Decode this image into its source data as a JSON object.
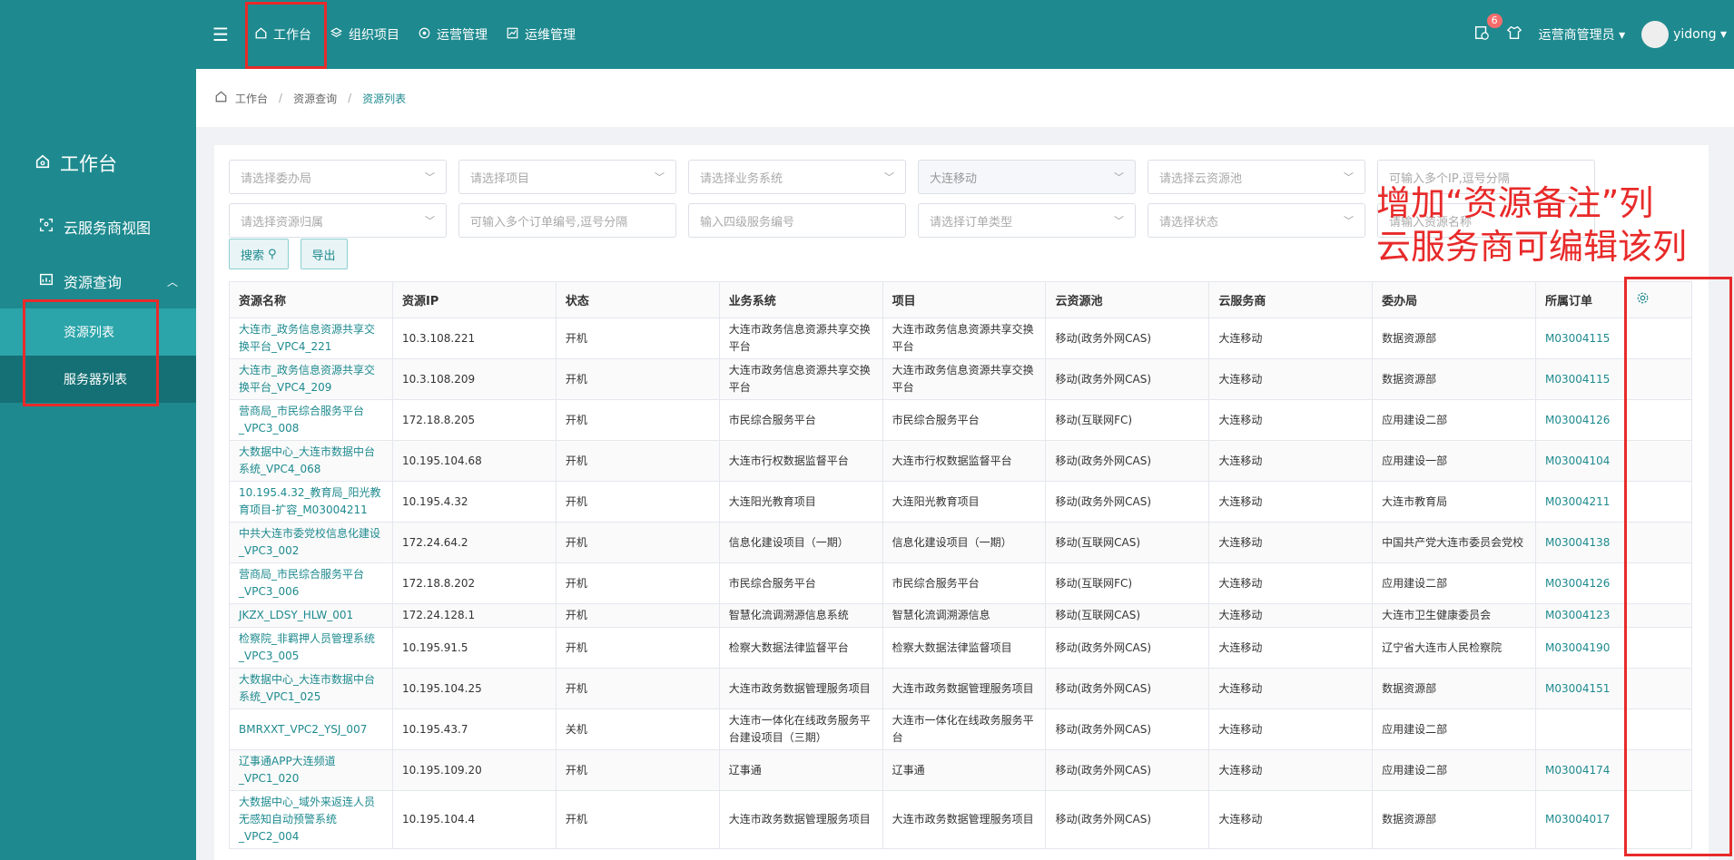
{
  "sidebar": {
    "title": "工作台",
    "items": [
      {
        "label": "云服务商视图"
      },
      {
        "label": "资源查询"
      }
    ],
    "sub_items": [
      {
        "label": "资源列表"
      },
      {
        "label": "服务器列表"
      }
    ]
  },
  "topnav": {
    "items": [
      {
        "label": "工作台"
      },
      {
        "label": "组织项目"
      },
      {
        "label": "运营管理"
      },
      {
        "label": "运维管理"
      }
    ],
    "badge_count": "6",
    "role": "运营商管理员",
    "user": "yidong"
  },
  "breadcrumb": [
    "工作台",
    "资源查询",
    "资源列表"
  ],
  "filters": {
    "row1": [
      "请选择委办局",
      "请选择项目",
      "请选择业务系统",
      "大连移动",
      "请选择云资源池",
      "可输入多个IP,逗号分隔"
    ],
    "row2": [
      "请选择资源归属",
      "可输入多个订单编号,逗号分隔",
      "输入四级服务编号",
      "请选择订单类型",
      "请选择状态",
      "请输入资源名称"
    ]
  },
  "buttons": {
    "search": "搜索",
    "export": "导出"
  },
  "annotation": {
    "line1": "增加“资源备注”列",
    "line2": "云服务商可编辑该列"
  },
  "table": {
    "headers": [
      "资源名称",
      "资源IP",
      "状态",
      "业务系统",
      "项目",
      "云资源池",
      "云服务商",
      "委办局",
      "所属订单"
    ],
    "rows": [
      [
        "大连市_政务信息资源共享交换平台_VPC4_221",
        "10.3.108.221",
        "开机",
        "大连市政务信息资源共享交换平台",
        "大连市政务信息资源共享交换平台",
        "移动(政务外网CAS)",
        "大连移动",
        "数据资源部",
        "M03004115"
      ],
      [
        "大连市_政务信息资源共享交换平台_VPC4_209",
        "10.3.108.209",
        "开机",
        "大连市政务信息资源共享交换平台",
        "大连市政务信息资源共享交换平台",
        "移动(政务外网CAS)",
        "大连移动",
        "数据资源部",
        "M03004115"
      ],
      [
        "营商局_市民综合服务平台_VPC3_008",
        "172.18.8.205",
        "开机",
        "市民综合服务平台",
        "市民综合服务平台",
        "移动(互联网FC)",
        "大连移动",
        "应用建设二部",
        "M03004126"
      ],
      [
        "大数据中心_大连市数据中台系统_VPC4_068",
        "10.195.104.68",
        "开机",
        "大连市行权数据监督平台",
        "大连市行权数据监督平台",
        "移动(政务外网CAS)",
        "大连移动",
        "应用建设一部",
        "M03004104"
      ],
      [
        "10.195.4.32_教育局_阳光教育项目-扩容_M03004211",
        "10.195.4.32",
        "开机",
        "大连阳光教育项目",
        "大连阳光教育项目",
        "移动(政务外网CAS)",
        "大连移动",
        "大连市教育局",
        "M03004211"
      ],
      [
        "中共大连市委党校信息化建设_VPC3_002",
        "172.24.64.2",
        "开机",
        "信息化建设项目（一期）",
        "信息化建设项目（一期）",
        "移动(互联网CAS)",
        "大连移动",
        "中国共产党大连市委员会党校",
        "M03004138"
      ],
      [
        "营商局_市民综合服务平台_VPC3_006",
        "172.18.8.202",
        "开机",
        "市民综合服务平台",
        "市民综合服务平台",
        "移动(互联网FC)",
        "大连移动",
        "应用建设二部",
        "M03004126"
      ],
      [
        "JKZX_LDSY_HLW_001",
        "172.24.128.1",
        "开机",
        "智慧化流调溯源信息系统",
        "智慧化流调溯源信息",
        "移动(互联网CAS)",
        "大连移动",
        "大连市卫生健康委员会",
        "M03004123"
      ],
      [
        "检察院_非羁押人员管理系统_VPC3_005",
        "10.195.91.5",
        "开机",
        "检察大数据法律监督平台",
        "检察大数据法律监督项目",
        "移动(政务外网CAS)",
        "大连移动",
        "辽宁省大连市人民检察院",
        "M03004190"
      ],
      [
        "大数据中心_大连市数据中台系统_VPC1_025",
        "10.195.104.25",
        "开机",
        "大连市政务数据管理服务项目",
        "大连市政务数据管理服务项目",
        "移动(政务外网CAS)",
        "大连移动",
        "数据资源部",
        "M03004151"
      ],
      [
        "BMRXXT_VPC2_YSJ_007",
        "10.195.43.7",
        "关机",
        "大连市一体化在线政务服务平台建设项目（三期）",
        "大连市一体化在线政务服务平台",
        "移动(政务外网CAS)",
        "大连移动",
        "应用建设二部",
        ""
      ],
      [
        "辽事通APP大连频道_VPC1_020",
        "10.195.109.20",
        "开机",
        "辽事通",
        "辽事通",
        "移动(政务外网CAS)",
        "大连移动",
        "应用建设二部",
        "M03004174"
      ],
      [
        "大数据中心_域外来返连人员无感知自动预警系统_VPC2_004",
        "10.195.104.4",
        "开机",
        "大连市政务数据管理服务项目",
        "大连市政务数据管理服务项目",
        "移动(政务外网CAS)",
        "大连移动",
        "数据资源部",
        "M03004017"
      ]
    ]
  }
}
